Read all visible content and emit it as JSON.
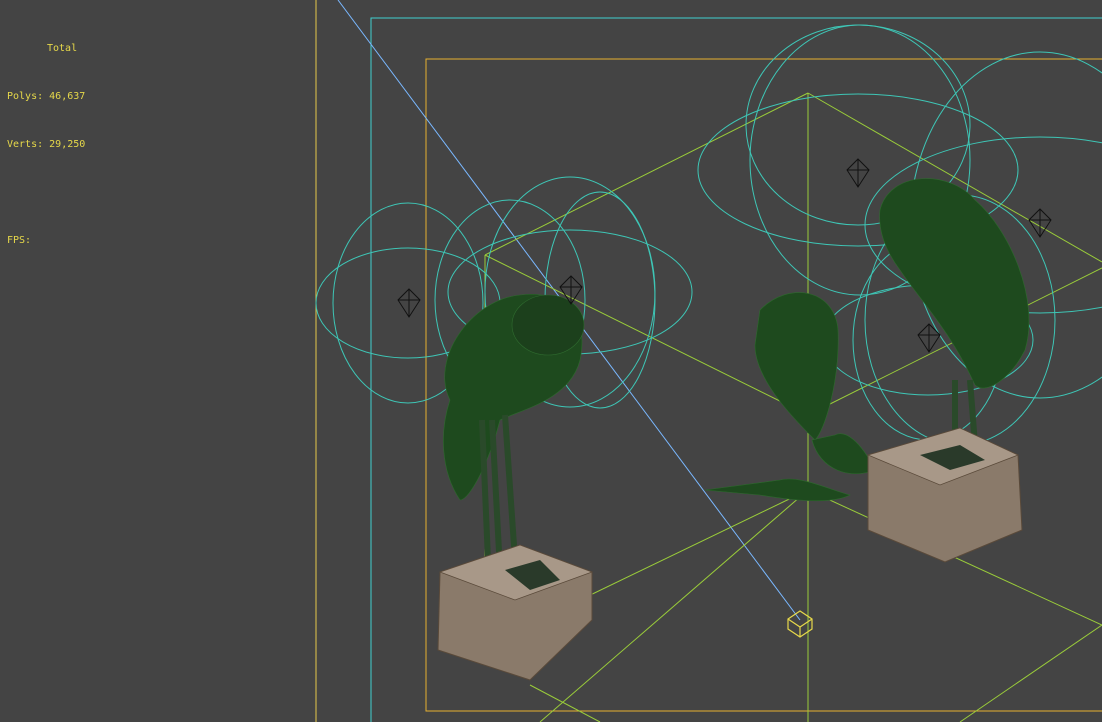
{
  "stats": {
    "header": "Total",
    "polys_label": "Polys:",
    "polys_value": "46,637",
    "verts_label": "Verts:",
    "verts_value": "29,250",
    "fps_label": "FPS:"
  },
  "colors": {
    "viewport_bg": "#444444",
    "stats_text": "#e6d84a",
    "safe_frame_outer": "#e6c84a",
    "safe_frame_action": "#3fd0d0",
    "safe_frame_title": "#e6b030",
    "light_helper": "#3ec6b6",
    "camera_line": "#7ab8ff",
    "target_frustum": "#9acc3a",
    "mesh_green": "#1e4a1e",
    "mesh_base": "#8a7a6a"
  },
  "icons": {
    "omni_light": "octahedron-light-icon",
    "camera_target": "cube-target-icon"
  }
}
